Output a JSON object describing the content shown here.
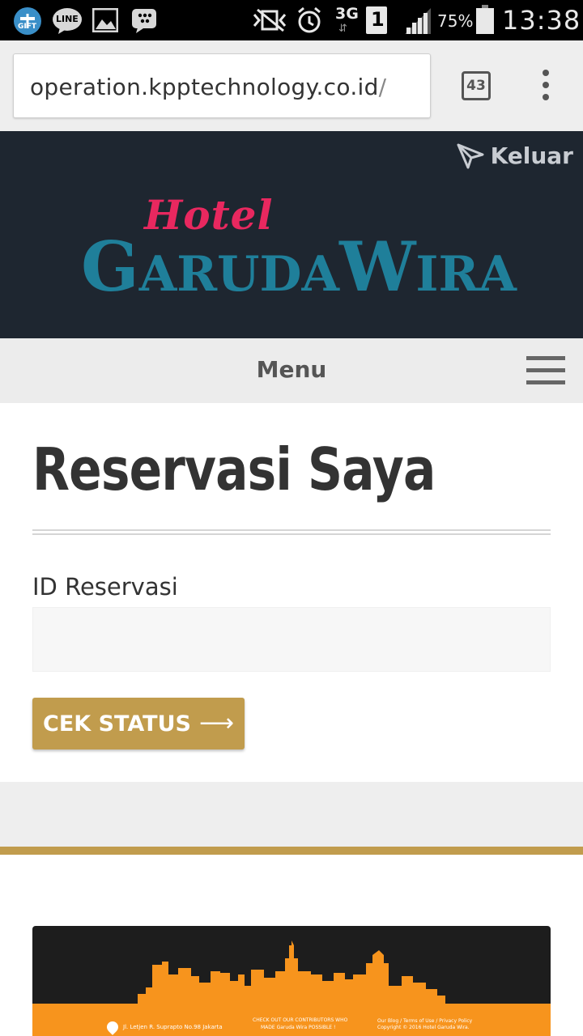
{
  "status_bar": {
    "icons": [
      "gift-icon",
      "line-icon",
      "gallery-icon",
      "bbm-icon",
      "mute-icon",
      "alarm-icon",
      "network-3g-icon",
      "sim-1-icon",
      "signal-icon",
      "battery-icon"
    ],
    "gift_label": "GIFT",
    "line_label": "LINE",
    "network": "3G",
    "sim": "1",
    "battery": "75%",
    "time": "13:38"
  },
  "browser": {
    "url": "operation.kpptechnology.co.id",
    "url_trailing": "/",
    "tab_count": "43"
  },
  "header": {
    "logout_label": "Keluar",
    "logo_script": "Hotel",
    "logo_main": "GarudaWira",
    "colors": {
      "background": "#1e2630",
      "logo_blue": "#1f7f9a",
      "logo_pink": "#e8285f"
    }
  },
  "menu": {
    "label": "Menu"
  },
  "main": {
    "title": "Reservasi Saya",
    "field_label": "ID Reservasi",
    "field_value": "",
    "button_label": "CEK STATUS",
    "button_arrow": "⟶",
    "colors": {
      "accent": "#c19c4d"
    }
  },
  "footer": {
    "address": "Jl. Letjen R. Suprapto No.98 Jakarta",
    "contrib_line1": "CHECK OUT OUR CONTRIBUTORS WHO",
    "contrib_line2": "MADE Garuda Wira POSSIBLE !",
    "links": "Our Blog / Terms of Use / Privacy Policy",
    "copyright": "Copyright © 2016 Hotel Garuda Wira.",
    "colors": {
      "orange": "#f7941d",
      "dark": "#1d1d1d"
    }
  }
}
